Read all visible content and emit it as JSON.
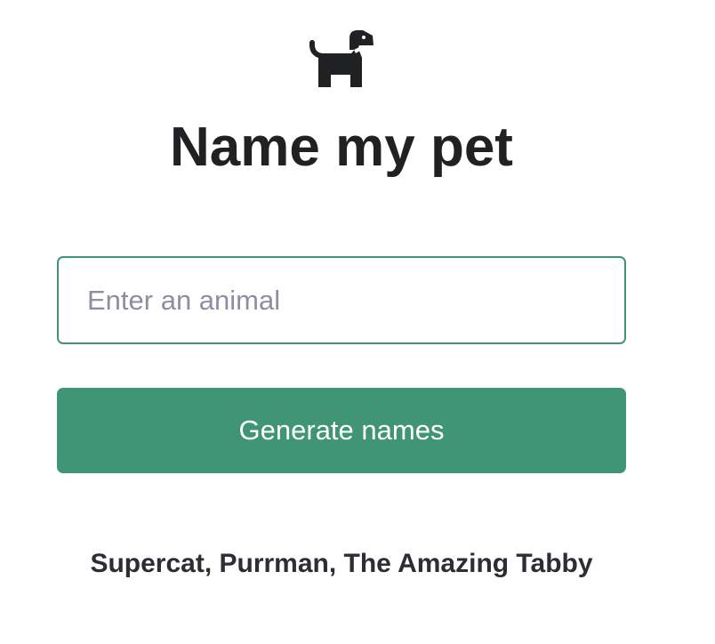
{
  "app": {
    "logo_icon": "dog-icon",
    "title": "Name my pet"
  },
  "form": {
    "animal_input": {
      "value": "",
      "placeholder": "Enter an animal"
    },
    "submit_label": "Generate names"
  },
  "result": {
    "text": "Supercat, Purrman, The Amazing Tabby"
  },
  "colors": {
    "accent": "#3f9574",
    "input_border": "#3e9474",
    "title_text": "#202123",
    "placeholder_text": "#8e8ea0",
    "button_text": "#ffffff"
  }
}
